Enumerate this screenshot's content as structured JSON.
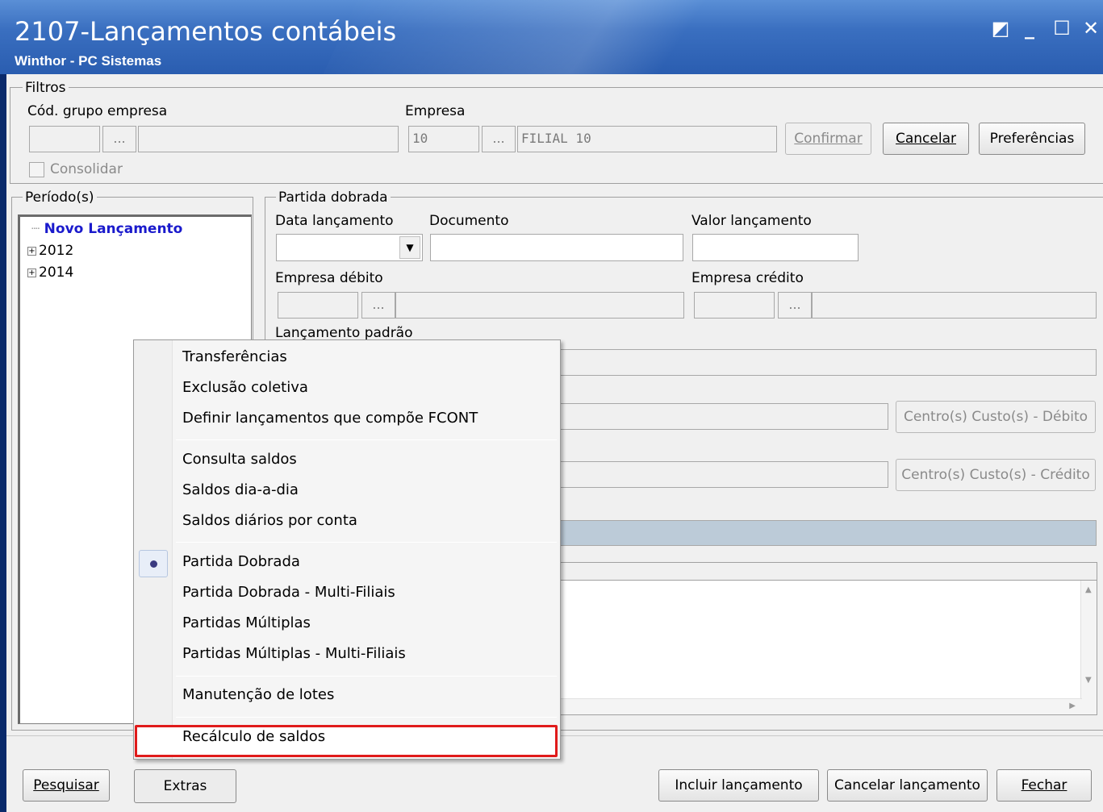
{
  "window": {
    "title": "2107-Lançamentos contábeis",
    "subtitle": "Winthor - PC Sistemas",
    "btn_restore": "◩",
    "btn_min": "_",
    "btn_max": "☐",
    "btn_close": "✕"
  },
  "filtros": {
    "group_label": "Filtros",
    "cod_grupo_label": "Cód. grupo empresa",
    "empresa_label": "Empresa",
    "empresa_code": "10",
    "empresa_name": "FILIAL 10",
    "dots": "...",
    "confirmar": "Confirmar",
    "cancelar": "Cancelar",
    "preferencias": "Preferências",
    "consolidar": "Consolidar"
  },
  "periodos": {
    "group_label": "Período(s)",
    "items": [
      "Novo Lançamento",
      "2012",
      "2014"
    ]
  },
  "partida": {
    "group_label": "Partida dobrada",
    "data_label": "Data lançamento",
    "documento_label": "Documento",
    "valor_label": "Valor lançamento",
    "empresa_debito_label": "Empresa débito",
    "empresa_credito_label": "Empresa crédito",
    "lancamento_padrao_label": "Lançamento padrão",
    "cc_debito": "Centro(s) Custo(s) - Débito",
    "cc_credito": "Centro(s) Custo(s) - Crédito"
  },
  "menu": {
    "items": [
      "Transferências",
      "Exclusão coletiva",
      "Definir lançamentos que compõe FCONT",
      "Consulta saldos",
      "Saldos dia-a-dia",
      "Saldos diários por conta",
      "Partida Dobrada",
      "Partida Dobrada - Multi-Filiais",
      "Partidas Múltiplas",
      "Partidas Múltiplas - Multi-Filiais",
      "Manutenção de lotes",
      "Recálculo de saldos"
    ],
    "checked_item": "Partida Dobrada",
    "highlighted_item": "Recálculo de saldos"
  },
  "footer": {
    "pesquisar": "Pesquisar",
    "extras": "Extras",
    "incluir": "Incluir lançamento",
    "cancelar_lanc": "Cancelar lançamento",
    "fechar": "Fechar"
  },
  "colors": {
    "accent_link": "#1a1acc",
    "highlight_border": "#e01b1b"
  }
}
